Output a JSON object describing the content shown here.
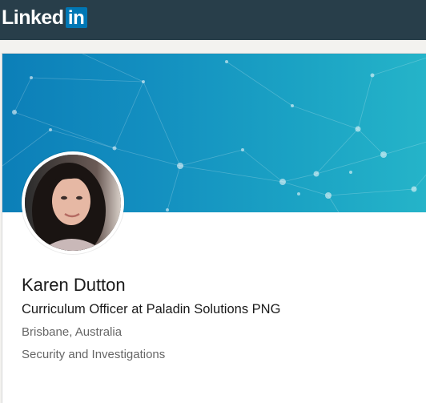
{
  "brand": {
    "logo_text": "Linked",
    "logo_box_text": "in",
    "bar_color": "#283e4a",
    "box_color": "#0077b5"
  },
  "profile": {
    "name": "Karen Dutton",
    "headline": "Curriculum Officer at Paladin Solutions PNG",
    "location": "Brisbane, Australia",
    "industry": "Security and Investigations",
    "avatar_icon": "profile-photo",
    "banner_icon": "network-pattern-banner",
    "banner_color": "#1a9bc3"
  }
}
